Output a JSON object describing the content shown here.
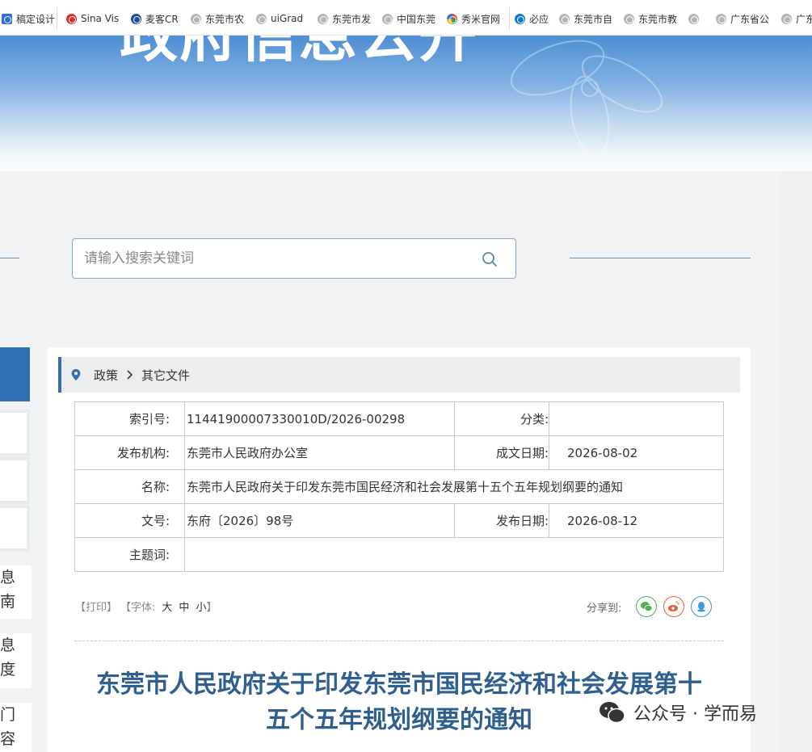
{
  "bookmarks": [
    {
      "label": "稿定设计",
      "icon": "gaoding-icon"
    },
    {
      "label": "Sina Vis",
      "icon": "sina-weibo-icon"
    },
    {
      "label": "麦客CR",
      "icon": "maike-icon"
    },
    {
      "label": "东莞市农",
      "icon": "globe-icon"
    },
    {
      "label": "uiGrad",
      "icon": "globe-icon"
    },
    {
      "label": "东莞市发",
      "icon": "globe-icon"
    },
    {
      "label": "中国东莞",
      "icon": "globe-icon"
    },
    {
      "label": "秀米官网",
      "icon": "xiumi-icon"
    },
    {
      "label": "必应",
      "icon": "bing-icon"
    },
    {
      "label": "东莞市自",
      "icon": "globe-icon"
    },
    {
      "label": "东莞市教",
      "icon": "globe-icon"
    },
    {
      "label": "",
      "icon": "globe-icon"
    },
    {
      "label": "广东省公",
      "icon": "globe-icon"
    },
    {
      "label": "广东",
      "icon": "globe-icon"
    }
  ],
  "banner": {
    "title": "政府信息公开"
  },
  "search": {
    "placeholder": "请输入搜索关键词"
  },
  "left_nav": {
    "tab1": "息\n南",
    "tab2": "息\n度",
    "tab3": "门\n容"
  },
  "breadcrumb": {
    "level1": "政策",
    "level2": "其它文件"
  },
  "info": {
    "index_label": "索引号:",
    "index_value": "11441900007330010D/2026-00298",
    "category_label": "分类:",
    "category_value": "",
    "publisher_label": "发布机构:",
    "publisher_value": "东莞市人民政府办公室",
    "created_label": "成文日期:",
    "created_value": "2026-08-02",
    "name_label": "名称:",
    "name_value": "东莞市人民政府关于印发东莞市国民经济和社会发展第十五个五年规划纲要的通知",
    "docno_label": "文号:",
    "docno_value": "东府〔2026〕98号",
    "published_label": "发布日期:",
    "published_value": "2026-08-12",
    "subject_label": "主题词:",
    "subject_value": ""
  },
  "tools": {
    "print": "【打印】",
    "font_label": "【字体:",
    "font_large": "大",
    "font_medium": "中",
    "font_small": "小",
    "close": "】"
  },
  "share": {
    "label": "分享到:"
  },
  "document": {
    "title_line1": "东莞市人民政府关于印发东莞市国民经济和社会发展第十",
    "title_line2": "五个五年规划纲要的通知"
  },
  "watermark": {
    "text": "公众号 · 学而易"
  },
  "colors": {
    "accent": "#2f6fb5",
    "title": "#2f5f8f",
    "wechat": "#4caf50",
    "weibo": "#e0603b",
    "qq": "#3c9ad8"
  }
}
